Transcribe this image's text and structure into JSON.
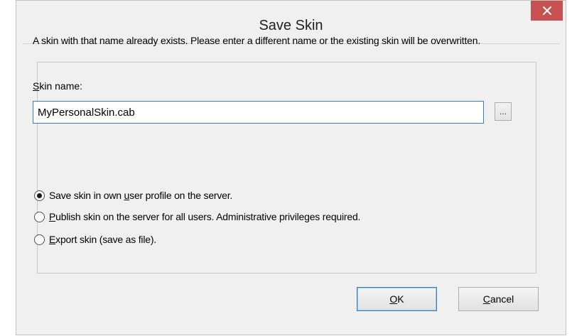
{
  "window": {
    "title": "Save Skin",
    "close_label": "×"
  },
  "message": "A skin with that name already exists. Please enter a different name or the existing skin will be overwritten.",
  "skin_name": {
    "label_accel": "S",
    "label_rest": "kin name:",
    "value": "MyPersonalSkin.cab",
    "browse_label": "..."
  },
  "options": [
    {
      "pre": "Save skin in own ",
      "accel": "u",
      "post": "ser profile on the server.",
      "checked": true
    },
    {
      "pre": "",
      "accel": "P",
      "post": "ublish skin on the server for all users. Administrative privileges required.",
      "checked": false
    },
    {
      "pre": "",
      "accel": "E",
      "post": "xport skin (save as file).",
      "checked": false
    }
  ],
  "buttons": {
    "ok_accel": "O",
    "ok_rest": "K",
    "cancel_accel": "C",
    "cancel_rest": "ancel"
  },
  "colors": {
    "close_bg": "#c75050",
    "focus_border": "#3c7fb1"
  }
}
